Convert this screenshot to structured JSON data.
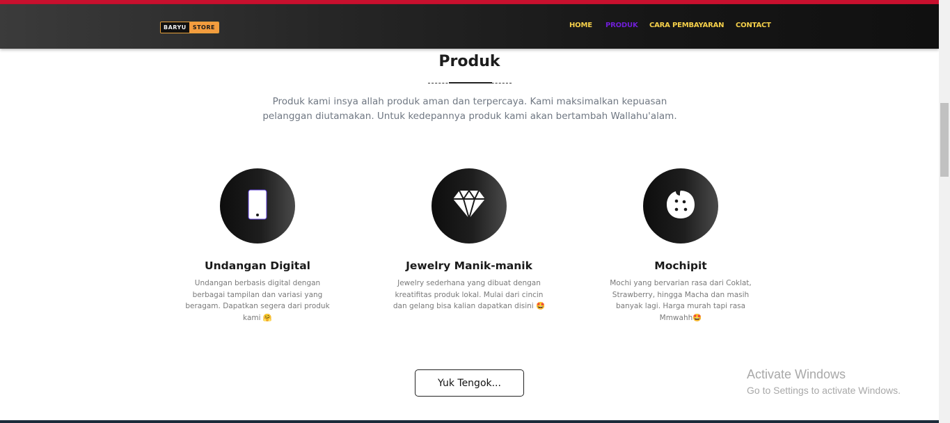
{
  "header": {
    "logo": {
      "part1": "BARYU",
      "part2": "STORE"
    },
    "nav": [
      {
        "label": "HOME",
        "active": false
      },
      {
        "label": "PRODUK",
        "active": true
      },
      {
        "label": "CARA PEMBAYARAN",
        "active": false
      },
      {
        "label": "CONTACT",
        "active": false
      }
    ]
  },
  "section": {
    "title": "Produk",
    "description": "Produk kami insya allah produk aman dan terpercaya. Kami maksimalkan kepuasan pelanggan diutamakan. Untuk kedepannya produk kami akan bertambah Wallahu'alam."
  },
  "products": [
    {
      "icon": "mobile-phone-icon",
      "name": "Undangan Digital",
      "description": "Undangan berbasis digital dengan berbagai tampilan dan variasi yang beragam. Dapatkan segera dari produk kami 🤗"
    },
    {
      "icon": "diamond-icon",
      "name": "Jewelry Manik-manik",
      "description": "Jewelry sederhana yang dibuat dengan kreatifitas produk lokal. Mulai dari cincin dan gelang bisa kalian dapatkan disini 🤩"
    },
    {
      "icon": "cookie-icon",
      "name": "Mochipit",
      "description": "Mochi yang bervarian rasa dari Coklat, Strawberry, hingga Macha dan masih banyak lagi. Harga murah tapi rasa Mmwahh🤩"
    }
  ],
  "cta": {
    "label": "Yuk Tengok..."
  },
  "watermark": {
    "title": "Activate Windows",
    "subtitle": "Go to Settings to activate Windows."
  },
  "colors": {
    "nav_text": "#f5d04a",
    "nav_active": "#6f1ed6",
    "top_stripe": "#c8102e",
    "logo_accent": "#f39c3e"
  }
}
